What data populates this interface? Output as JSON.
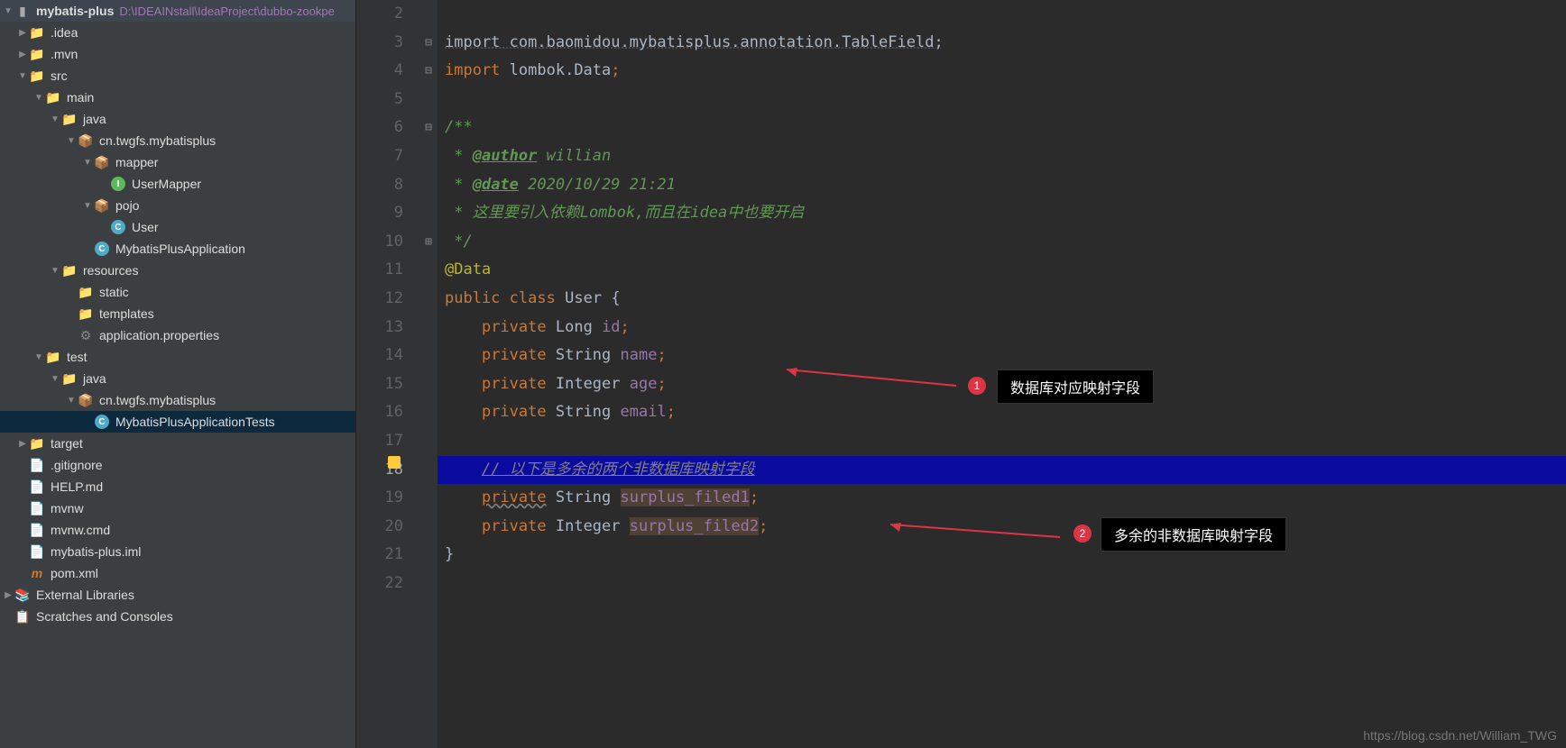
{
  "project": {
    "name": "mybatis-plus",
    "path": "D:\\IDEAINstall\\IdeaProject\\dubbo-zookpe"
  },
  "tree": {
    "idea": ".idea",
    "mvn": ".mvn",
    "src": "src",
    "main": "main",
    "java": "java",
    "pkg": "cn.twgfs.mybatisplus",
    "mapper": "mapper",
    "userMapper": "UserMapper",
    "pojo": "pojo",
    "user": "User",
    "app": "MybatisPlusApplication",
    "resources": "resources",
    "static": "static",
    "templates": "templates",
    "appProps": "application.properties",
    "test": "test",
    "javaTest": "java",
    "pkgTest": "cn.twgfs.mybatisplus",
    "appTests": "MybatisPlusApplicationTests",
    "target": "target",
    "gitignore": ".gitignore",
    "help": "HELP.md",
    "mvnw": "mvnw",
    "mvnwCmd": "mvnw.cmd",
    "iml": "mybatis-plus.iml",
    "pom": "pom.xml",
    "extLib": "External Libraries",
    "scratch": "Scratches and Consoles"
  },
  "code": {
    "import1": "import com.baomidou.mybatisplus.annotation.TableField;",
    "import2_kw": "import",
    "import2_path": " lombok.",
    "import2_cls": "Data",
    "doc_start": "/**",
    "doc_author_tag": "@author",
    "doc_author_val": " willian",
    "doc_date_tag": "@date",
    "doc_date_val": " 2020/10/29 21:21",
    "doc_desc": " * 这里要引入依赖Lombok,而且在idea中也要开启",
    "doc_end": " */",
    "anno": "@Data",
    "cls_decl_kw1": "public",
    "cls_decl_kw2": "class",
    "cls_decl_name": "User",
    "cls_brace": "{",
    "f1_kw": "private",
    "f1_type": "Long",
    "f1_name": "id",
    "f2_kw": "private",
    "f2_type": "String",
    "f2_name": "name",
    "f3_kw": "private",
    "f3_type": "Integer",
    "f3_name": "age",
    "f4_kw": "private",
    "f4_type": "String",
    "f4_name": "email",
    "comment_extra": "// 以下是多余的两个非数据库映射字段",
    "f5_kw": "private",
    "f5_type": "String",
    "f5_name": "surplus_filed1",
    "f6_kw": "private",
    "f6_type": "Integer",
    "f6_name": "surplus_filed2",
    "close_brace": "}"
  },
  "annotations": {
    "num1": "1",
    "label1": "数据库对应映射字段",
    "num2": "2",
    "label2": "多余的非数据库映射字段"
  },
  "watermark": "https://blog.csdn.net/William_TWG"
}
